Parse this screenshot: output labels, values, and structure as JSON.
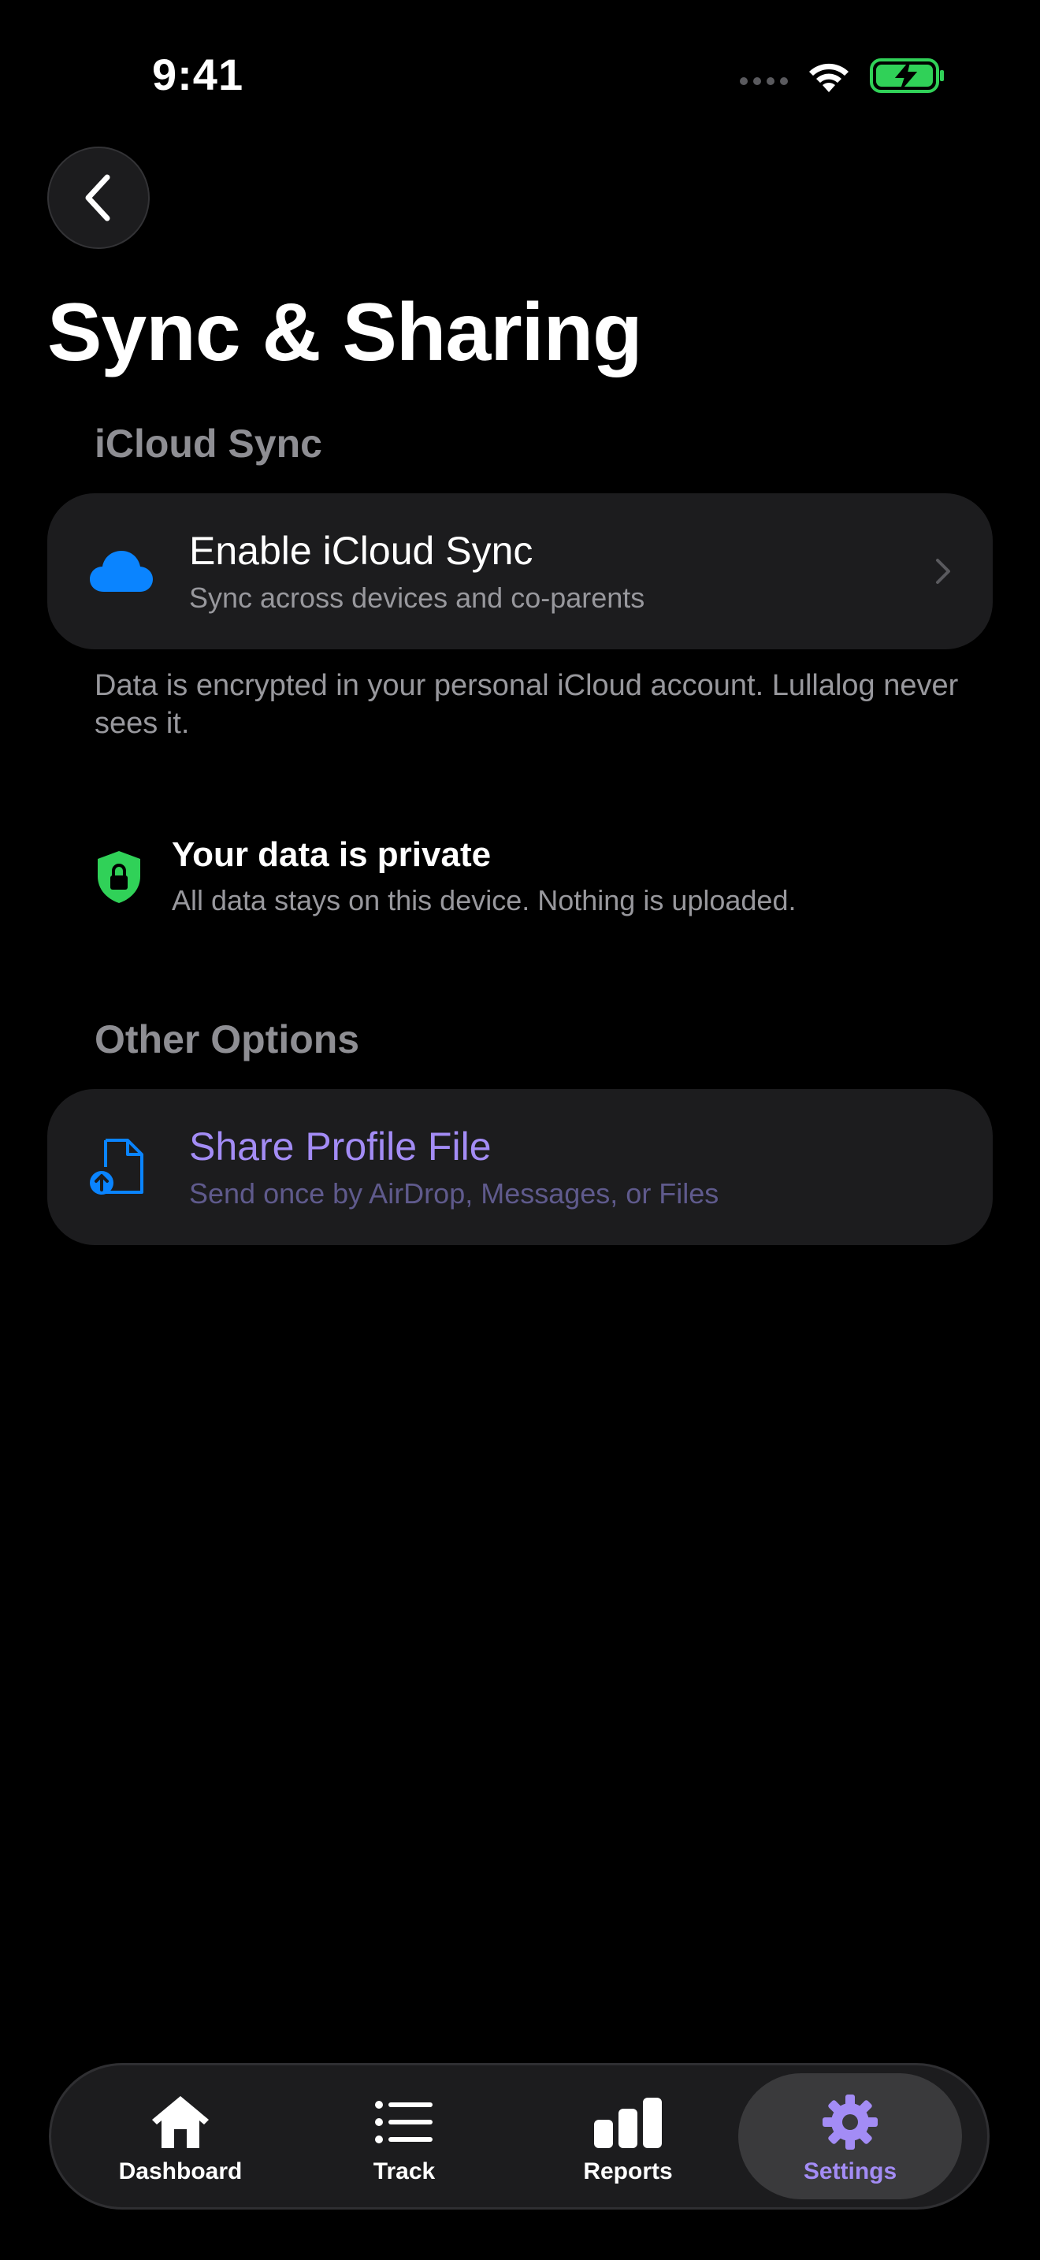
{
  "status_bar": {
    "time": "9:41"
  },
  "header": {
    "back_icon": "chevron-left-icon",
    "title": "Sync & Sharing"
  },
  "icloud_section": {
    "label": "iCloud Sync",
    "card": {
      "icon": "cloud-icon",
      "title": "Enable iCloud Sync",
      "subtitle": "Sync across devices and co-parents"
    },
    "footnote": "Data is encrypted in your personal iCloud account. Lullalog never sees it."
  },
  "privacy": {
    "icon": "lock-shield-icon",
    "title": "Your data is private",
    "subtitle": "All data stays on this device. Nothing is uploaded."
  },
  "other_section": {
    "label": "Other Options",
    "card": {
      "icon": "document-upload-icon",
      "title": "Share Profile File",
      "subtitle": "Send once by AirDrop, Messages, or Files"
    }
  },
  "tab_bar": {
    "tabs": [
      {
        "label": "Dashboard",
        "icon": "house-icon",
        "active": false
      },
      {
        "label": "Track",
        "icon": "list-icon",
        "active": false
      },
      {
        "label": "Reports",
        "icon": "bar-chart-icon",
        "active": false
      },
      {
        "label": "Settings",
        "icon": "gear-icon",
        "active": true
      }
    ]
  },
  "colors": {
    "background": "#000000",
    "card": "#1c1c1e",
    "accent": "#a38cf5",
    "icloud_blue": "#0a84ff",
    "privacy_green": "#30d158",
    "battery_green": "#30d158"
  }
}
